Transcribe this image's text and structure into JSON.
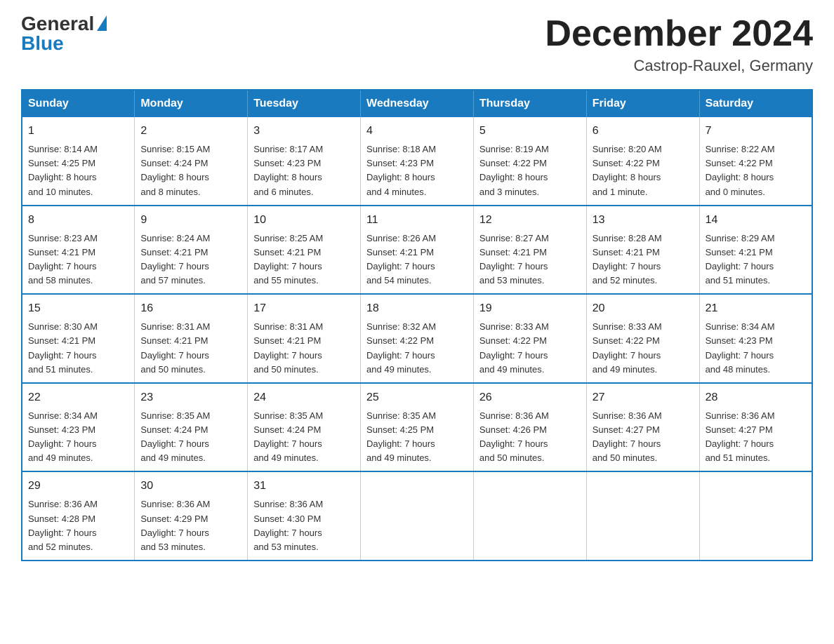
{
  "header": {
    "logo": {
      "general": "General",
      "blue": "Blue"
    },
    "title": "December 2024",
    "location": "Castrop-Rauxel, Germany"
  },
  "calendar": {
    "days_of_week": [
      "Sunday",
      "Monday",
      "Tuesday",
      "Wednesday",
      "Thursday",
      "Friday",
      "Saturday"
    ],
    "weeks": [
      [
        {
          "day": "1",
          "sunrise": "8:14 AM",
          "sunset": "4:25 PM",
          "daylight": "8 hours and 10 minutes."
        },
        {
          "day": "2",
          "sunrise": "8:15 AM",
          "sunset": "4:24 PM",
          "daylight": "8 hours and 8 minutes."
        },
        {
          "day": "3",
          "sunrise": "8:17 AM",
          "sunset": "4:23 PM",
          "daylight": "8 hours and 6 minutes."
        },
        {
          "day": "4",
          "sunrise": "8:18 AM",
          "sunset": "4:23 PM",
          "daylight": "8 hours and 4 minutes."
        },
        {
          "day": "5",
          "sunrise": "8:19 AM",
          "sunset": "4:22 PM",
          "daylight": "8 hours and 3 minutes."
        },
        {
          "day": "6",
          "sunrise": "8:20 AM",
          "sunset": "4:22 PM",
          "daylight": "8 hours and 1 minute."
        },
        {
          "day": "7",
          "sunrise": "8:22 AM",
          "sunset": "4:22 PM",
          "daylight": "8 hours and 0 minutes."
        }
      ],
      [
        {
          "day": "8",
          "sunrise": "8:23 AM",
          "sunset": "4:21 PM",
          "daylight": "7 hours and 58 minutes."
        },
        {
          "day": "9",
          "sunrise": "8:24 AM",
          "sunset": "4:21 PM",
          "daylight": "7 hours and 57 minutes."
        },
        {
          "day": "10",
          "sunrise": "8:25 AM",
          "sunset": "4:21 PM",
          "daylight": "7 hours and 55 minutes."
        },
        {
          "day": "11",
          "sunrise": "8:26 AM",
          "sunset": "4:21 PM",
          "daylight": "7 hours and 54 minutes."
        },
        {
          "day": "12",
          "sunrise": "8:27 AM",
          "sunset": "4:21 PM",
          "daylight": "7 hours and 53 minutes."
        },
        {
          "day": "13",
          "sunrise": "8:28 AM",
          "sunset": "4:21 PM",
          "daylight": "7 hours and 52 minutes."
        },
        {
          "day": "14",
          "sunrise": "8:29 AM",
          "sunset": "4:21 PM",
          "daylight": "7 hours and 51 minutes."
        }
      ],
      [
        {
          "day": "15",
          "sunrise": "8:30 AM",
          "sunset": "4:21 PM",
          "daylight": "7 hours and 51 minutes."
        },
        {
          "day": "16",
          "sunrise": "8:31 AM",
          "sunset": "4:21 PM",
          "daylight": "7 hours and 50 minutes."
        },
        {
          "day": "17",
          "sunrise": "8:31 AM",
          "sunset": "4:21 PM",
          "daylight": "7 hours and 50 minutes."
        },
        {
          "day": "18",
          "sunrise": "8:32 AM",
          "sunset": "4:22 PM",
          "daylight": "7 hours and 49 minutes."
        },
        {
          "day": "19",
          "sunrise": "8:33 AM",
          "sunset": "4:22 PM",
          "daylight": "7 hours and 49 minutes."
        },
        {
          "day": "20",
          "sunrise": "8:33 AM",
          "sunset": "4:22 PM",
          "daylight": "7 hours and 49 minutes."
        },
        {
          "day": "21",
          "sunrise": "8:34 AM",
          "sunset": "4:23 PM",
          "daylight": "7 hours and 48 minutes."
        }
      ],
      [
        {
          "day": "22",
          "sunrise": "8:34 AM",
          "sunset": "4:23 PM",
          "daylight": "7 hours and 49 minutes."
        },
        {
          "day": "23",
          "sunrise": "8:35 AM",
          "sunset": "4:24 PM",
          "daylight": "7 hours and 49 minutes."
        },
        {
          "day": "24",
          "sunrise": "8:35 AM",
          "sunset": "4:24 PM",
          "daylight": "7 hours and 49 minutes."
        },
        {
          "day": "25",
          "sunrise": "8:35 AM",
          "sunset": "4:25 PM",
          "daylight": "7 hours and 49 minutes."
        },
        {
          "day": "26",
          "sunrise": "8:36 AM",
          "sunset": "4:26 PM",
          "daylight": "7 hours and 50 minutes."
        },
        {
          "day": "27",
          "sunrise": "8:36 AM",
          "sunset": "4:27 PM",
          "daylight": "7 hours and 50 minutes."
        },
        {
          "day": "28",
          "sunrise": "8:36 AM",
          "sunset": "4:27 PM",
          "daylight": "7 hours and 51 minutes."
        }
      ],
      [
        {
          "day": "29",
          "sunrise": "8:36 AM",
          "sunset": "4:28 PM",
          "daylight": "7 hours and 52 minutes."
        },
        {
          "day": "30",
          "sunrise": "8:36 AM",
          "sunset": "4:29 PM",
          "daylight": "7 hours and 53 minutes."
        },
        {
          "day": "31",
          "sunrise": "8:36 AM",
          "sunset": "4:30 PM",
          "daylight": "7 hours and 53 minutes."
        },
        null,
        null,
        null,
        null
      ]
    ],
    "labels": {
      "sunrise": "Sunrise:",
      "sunset": "Sunset:",
      "daylight": "Daylight:"
    }
  }
}
